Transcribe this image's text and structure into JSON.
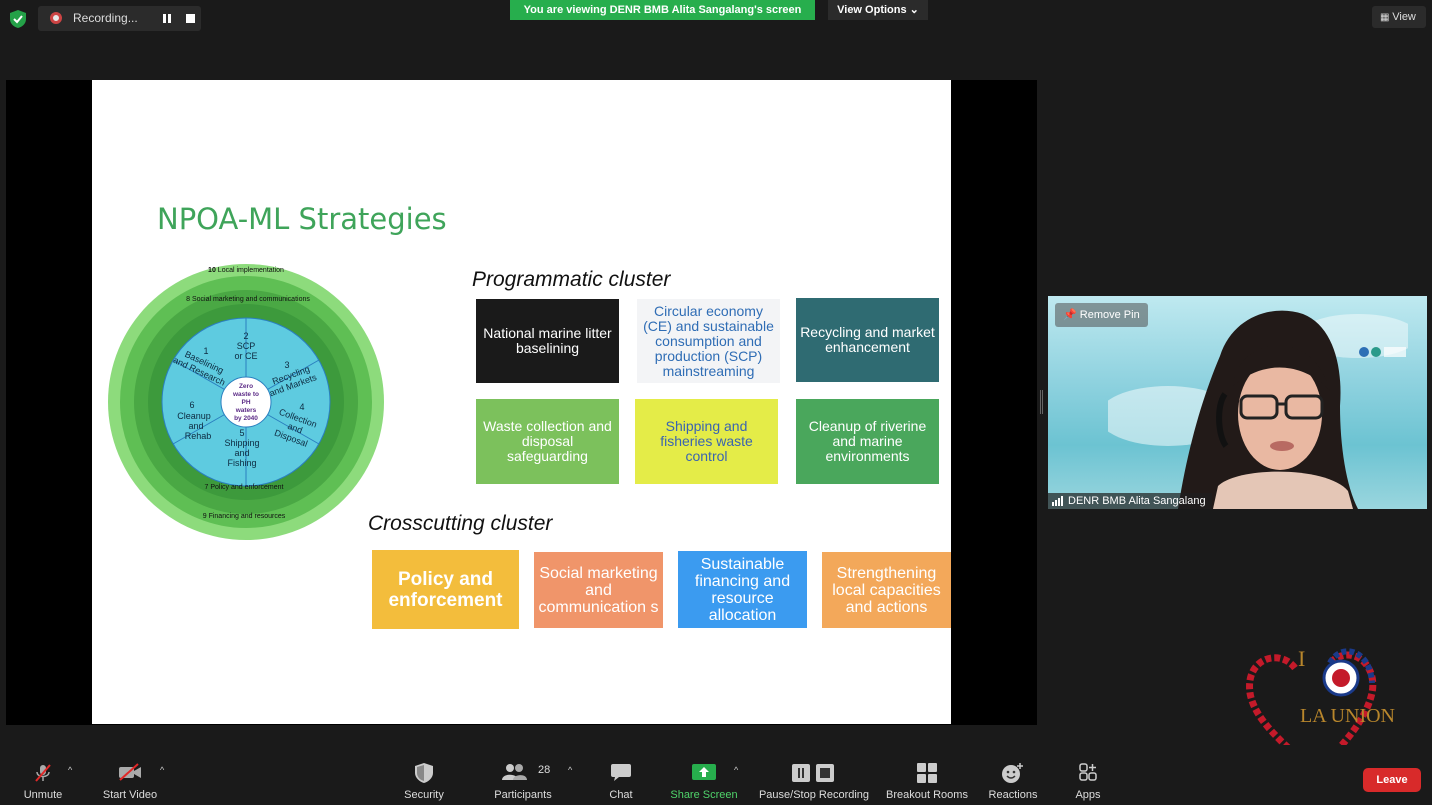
{
  "top_bar": {
    "recording_label": "Recording...",
    "viewing_banner": "You are viewing DENR BMB Alita Sangalang's screen",
    "view_options": "View Options ⌄",
    "view_label": "View"
  },
  "slide": {
    "title": "NPOA-ML Strategies",
    "wheel": {
      "center": [
        "Zero",
        "waste to",
        "PH",
        "waters",
        "by 2040"
      ],
      "inner_segments": [
        [
          "2",
          "SCP",
          "or CE"
        ],
        [
          "3",
          "Recycling",
          "and Markets"
        ],
        [
          "4",
          "Collection",
          "and",
          "Disposal"
        ],
        [
          "5",
          "Shipping",
          "and",
          "Fishing"
        ],
        [
          "6",
          "Cleanup",
          "and",
          "Rehab"
        ],
        [
          "1",
          "Baselining",
          "and Research"
        ]
      ],
      "outer_rings": {
        "ring_10": "Local implementation",
        "ring_10_num": "10",
        "ring_8": "8 Social marketing and communications",
        "ring_7": "7 Policy and enforcement",
        "ring_9": "9 Financing and resources"
      }
    },
    "programmatic_heading": "Programmatic cluster",
    "programmatic_boxes": [
      {
        "label": "National marine litter baselining",
        "bg": "#1a1a1a",
        "fg": "#ffffff"
      },
      {
        "label": "Circular economy (CE) and sustainable consumption and production (SCP) mainstreaming",
        "bg": "#f3f4f6",
        "fg": "#2f6db5"
      },
      {
        "label": "Recycling and market enhancement",
        "bg": "#2f6b72",
        "fg": "#ffffff"
      },
      {
        "label": "Waste collection and disposal safeguarding",
        "bg": "#7cc15c",
        "fg": "#ffffff"
      },
      {
        "label": "Shipping and fisheries waste control",
        "bg": "#e4ec48",
        "fg": "#3a64b0"
      },
      {
        "label": "Cleanup of riverine and marine environments",
        "bg": "#4aa75c",
        "fg": "#ffffff"
      }
    ],
    "crosscutting_heading": "Crosscutting cluster",
    "crosscutting_boxes": [
      {
        "label": "Policy and enforcement",
        "bg": "#f3bd3c",
        "fg": "#ffffff"
      },
      {
        "label": "Social marketing and communication s",
        "bg": "#f0956a",
        "fg": "#ffffff"
      },
      {
        "label": "Sustainable financing and resource allocation",
        "bg": "#3b9bf0",
        "fg": "#ffffff"
      },
      {
        "label": "Strengthening local capacities and actions",
        "bg": "#f3a85a",
        "fg": "#ffffff"
      }
    ]
  },
  "video": {
    "remove_pin": "Remove Pin",
    "participant_name": "DENR BMB Alita Sangalang"
  },
  "logo": {
    "letter": "I",
    "text": "LA UNION"
  },
  "toolbar": {
    "unmute": "Unmute",
    "start_video": "Start Video",
    "security": "Security",
    "participants": "Participants",
    "participants_count": "28",
    "chat": "Chat",
    "share_screen": "Share Screen",
    "pause_stop_recording": "Pause/Stop Recording",
    "breakout_rooms": "Breakout Rooms",
    "reactions": "Reactions",
    "apps": "Apps",
    "leave": "Leave"
  }
}
